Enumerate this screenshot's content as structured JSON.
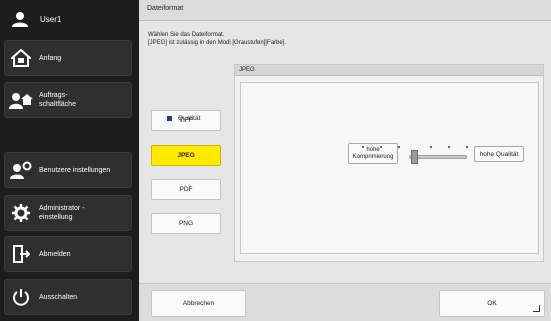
{
  "sidebar": {
    "user": "User1",
    "items": [
      {
        "label": "Anfang",
        "icon": "home-icon"
      },
      {
        "label": "Auftrags-\nschaltfläche",
        "icon": "job-button-icon"
      },
      {
        "label": "Benutzere instellungen",
        "icon": "user-settings-icon"
      },
      {
        "label": "Administrator -\neinstellung",
        "icon": "gear-icon"
      },
      {
        "label": "Abmelden",
        "icon": "logout-icon"
      },
      {
        "label": "Ausschalten",
        "icon": "power-icon"
      }
    ]
  },
  "main": {
    "title": "Dateiformat",
    "instruction": "Wählen Sie das Dateiformat.\n[JPEG] ist zulässig in den Modi [Graustufen][Farbe].",
    "formats": [
      "TIFF",
      "JPEG",
      "PDF",
      "PNG"
    ],
    "selected_format": "JPEG",
    "panel_title": "JPEG",
    "quality_label": "Qualität",
    "low_label": "hohe\nKomprimierung",
    "high_label": "hohe Qualität",
    "quality_level": 0.5,
    "cancel_label": "Abbrechen",
    "ok_label": "OK"
  },
  "colors": {
    "selected": "#ffea00",
    "quality_marker": "#2233aa"
  }
}
